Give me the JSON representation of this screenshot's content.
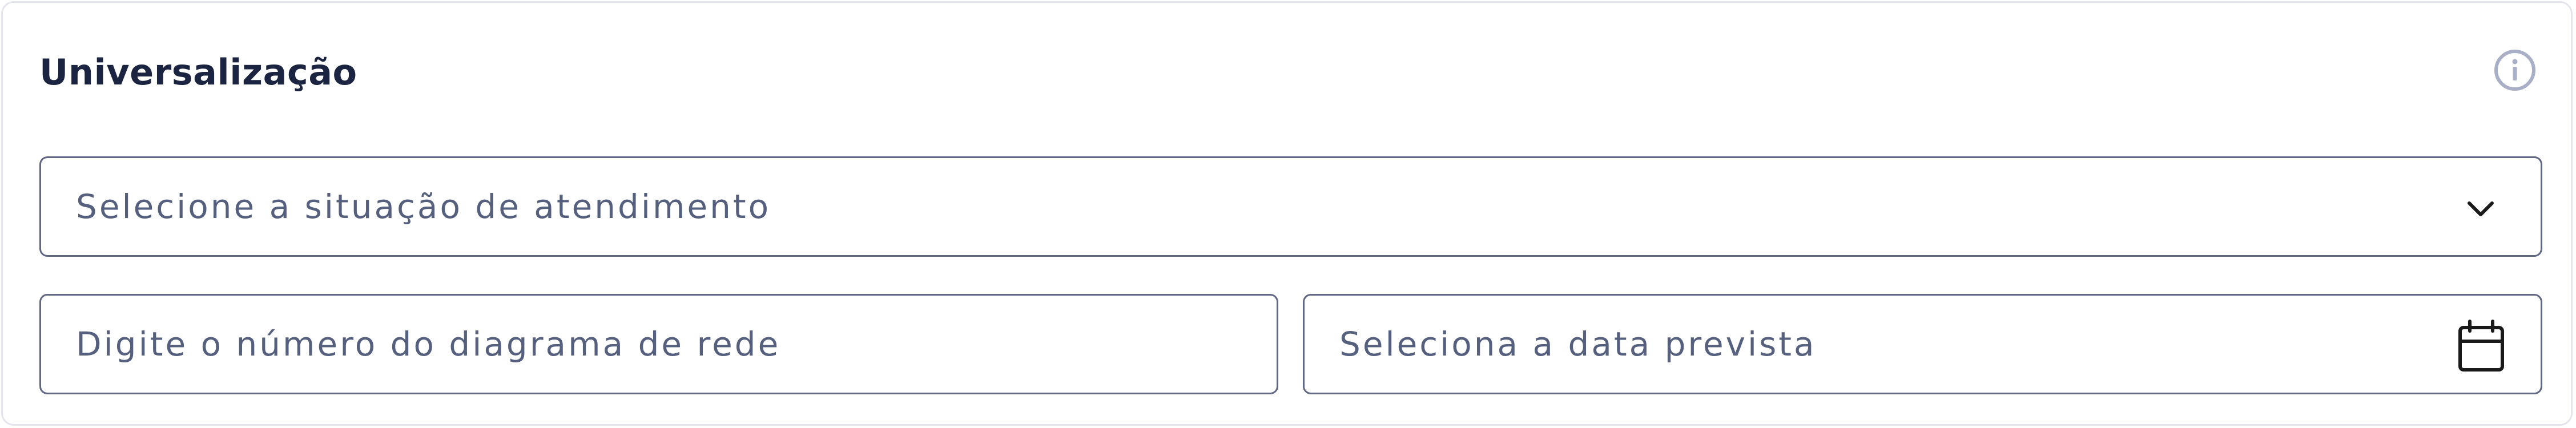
{
  "card": {
    "title": "Universalização",
    "info_icon": "info-circle-icon"
  },
  "service_status": {
    "placeholder": "Selecione a situação de atendimento",
    "icon": "chevron-down-icon"
  },
  "network_diagram": {
    "placeholder": "Digite o número do diagrama de rede"
  },
  "expected_date": {
    "placeholder": "Seleciona a data prevista",
    "icon": "calendar-icon"
  },
  "colors": {
    "border": "#5f6785",
    "card_border": "#e4e4ee",
    "title": "#1b2440",
    "placeholder": "#55607e",
    "info_icon": "#a8afc7",
    "icon": "#1a1a1a"
  }
}
